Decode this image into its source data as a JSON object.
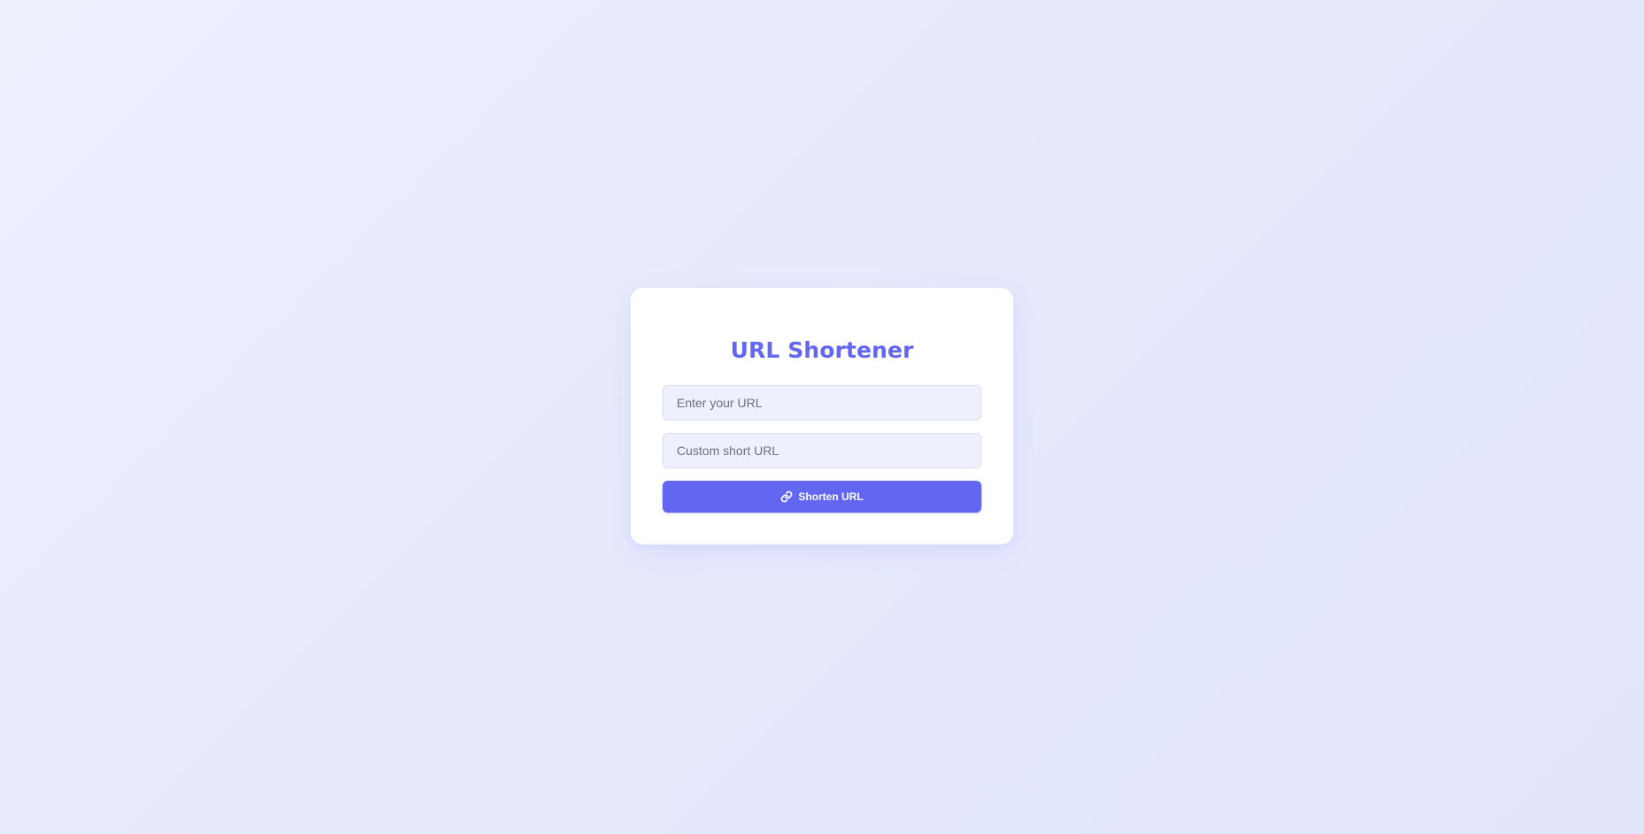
{
  "app": {
    "title": "URL Shortener"
  },
  "form": {
    "url_input": {
      "value": "",
      "placeholder": "Enter your URL"
    },
    "custom_input": {
      "value": "",
      "placeholder": "Custom short URL"
    },
    "submit": {
      "label": "Shorten URL",
      "icon": "link-icon"
    }
  },
  "colors": {
    "accent": "#6366f1",
    "input_bg": "#eff0fd",
    "card_bg": "#ffffff"
  }
}
